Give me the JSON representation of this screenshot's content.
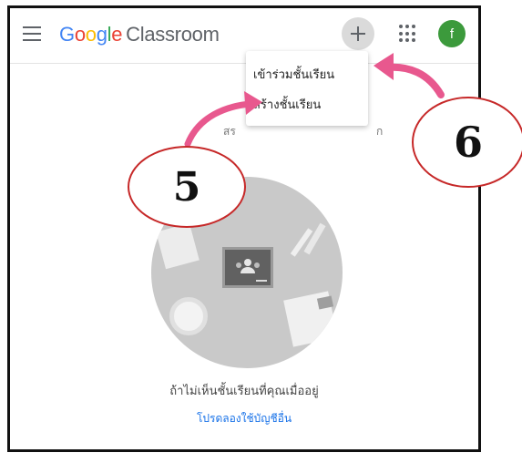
{
  "app": {
    "brand_google": "Google",
    "brand_product": "Classroom",
    "avatar_initial": "f"
  },
  "menu": {
    "join_label": "เข้าร่วมชั้นเรียน",
    "create_label": "สร้างชั้นเรียน"
  },
  "main": {
    "hint_visible_start": "สร",
    "hint_visible_end": "ก",
    "empty_text": "ถ้าไม่เห็นชั้นเรียนที่คุณเมื่ออยู่",
    "try_other_account_link": "โปรดลองใช้บัญชีอื่น"
  },
  "annotations": {
    "step_5": "5",
    "step_6": "6"
  },
  "colors": {
    "accent_pink": "#e8588e",
    "link_blue": "#1a73e8",
    "circle_red": "#c62828",
    "avatar_green": "#3c9a3c"
  },
  "icons": [
    "menu-icon",
    "plus-icon",
    "apps-grid-icon"
  ]
}
